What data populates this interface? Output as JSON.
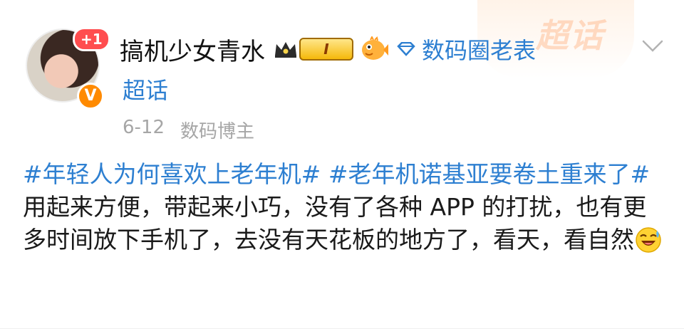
{
  "user": {
    "name": "搞机少女青水",
    "notification_count": "+1",
    "level": "I",
    "verified_icon": "verified-v-icon"
  },
  "supertopic": {
    "name": "数码圈老表",
    "suffix": "超话",
    "watermark": "超话"
  },
  "meta": {
    "date": "6-12",
    "role": "数码博主"
  },
  "post": {
    "hashtag1": "#年轻人为何喜欢上老年机#",
    "hashtag2": "#老年机诺基亚要卷土重来了#",
    "text": " 用起来方便，带起来小巧，没有了各种 APP 的打扰，也有更多时间放下手机了，去没有天花板的地方了，看天，看自然",
    "emoji": "laugh-cry-emoji"
  },
  "colors": {
    "link": "#2d7fd1",
    "meta": "#a6a6a6",
    "badge_red": "#ff4d4f",
    "verified_orange": "#ff8a00"
  }
}
